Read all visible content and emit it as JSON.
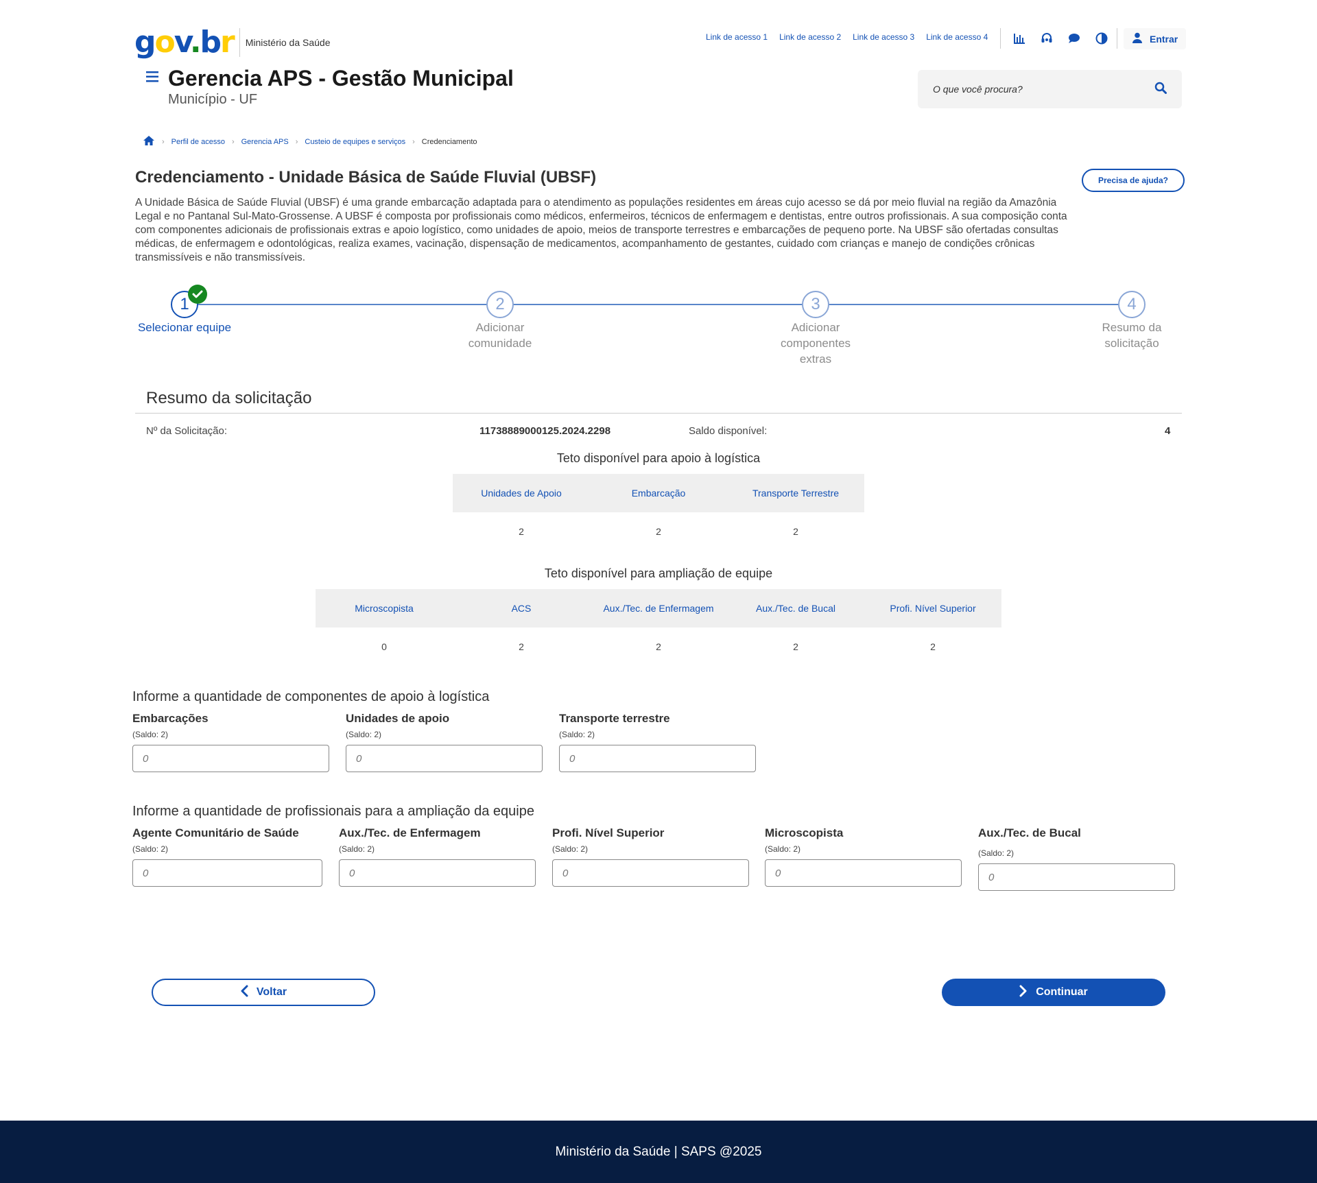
{
  "header": {
    "logo": {
      "part1": "g",
      "part2": "o",
      "part3": "v",
      "part4": ".",
      "part5": "b",
      "part6": "r"
    },
    "ministry": "Ministério da Saúde",
    "links": [
      "Link de acesso 1",
      "Link de acesso 2",
      "Link de acesso 3",
      "Link de acesso 4"
    ],
    "login_label": "Entrar",
    "icons": [
      "chart-icon",
      "headset-icon",
      "chat-icon",
      "contrast-icon",
      "user-icon"
    ]
  },
  "app": {
    "title": "Gerencia APS - Gestão Municipal",
    "subtitle": "Município - UF"
  },
  "search": {
    "placeholder": "O que você procura?"
  },
  "breadcrumb": {
    "items": [
      "Perfil de acesso",
      "Gerencia APS",
      "Custeio de equipes e serviços"
    ],
    "current": "Credenciamento"
  },
  "page": {
    "title": "Credenciamento - Unidade Básica de Saúde Fluvial (UBSF)",
    "help_label": "Precisa de ajuda?",
    "description": "A Unidade Básica de Saúde Fluvial (UBSF) é uma grande embarcação adaptada para o atendimento as populações residentes em áreas cujo acesso se dá por meio fluvial na região da Amazônia Legal e no Pantanal Sul-Mato-Grossense. A UBSF é composta por profissionais como médicos, enfermeiros, técnicos de enfermagem e dentistas, entre outros profissionais. A sua composição conta com componentes adicionais de profissionais extras e apoio logístico, como unidades de apoio, meios de transporte terrestres e embarcações de pequeno porte. Na UBSF são ofertadas consultas médicas, de enfermagem e odontológicas, realiza exames, vacinação, dispensação de medicamentos, acompanhamento de gestantes, cuidado com crianças e manejo de condições crônicas transmissíveis e não transmissíveis."
  },
  "stepper": {
    "steps": [
      {
        "number": "1",
        "label_line1": "Selecionar equipe",
        "label_line2": "",
        "label_line3": "",
        "status": "completed"
      },
      {
        "number": "2",
        "label_line1": "Adicionar",
        "label_line2": "comunidade",
        "label_line3": "",
        "status": "pending"
      },
      {
        "number": "3",
        "label_line1": "Adicionar",
        "label_line2": "componentes",
        "label_line3": "extras",
        "status": "pending"
      },
      {
        "number": "4",
        "label_line1": "Resumo da",
        "label_line2": "solicitação",
        "label_line3": "",
        "status": "pending"
      }
    ]
  },
  "summary": {
    "title": "Resumo da solicitação",
    "request_label": "Nº da Solicitação:",
    "request_value": "11738889000125.2024.2298",
    "balance_label": "Saldo disponível:",
    "balance_value": "4",
    "logistics_table": {
      "caption": "Teto disponível para apoio à logística",
      "headers": [
        "Unidades de Apoio",
        "Embarcação",
        "Transporte Terrestre"
      ],
      "values": [
        "2",
        "2",
        "2"
      ]
    },
    "team_table": {
      "caption": "Teto disponível para ampliação de equipe",
      "headers": [
        "Microscopista",
        "ACS",
        "Aux./Tec. de Enfermagem",
        "Aux./Tec. de Bucal",
        "Profi. Nível Superior"
      ],
      "values": [
        "0",
        "2",
        "2",
        "2",
        "2"
      ]
    }
  },
  "logistics_form": {
    "title": "Informe a quantidade de componentes de apoio à logística",
    "fields": [
      {
        "label": "Embarcações",
        "hint": "(Saldo: 2)",
        "placeholder": "0"
      },
      {
        "label": "Unidades de apoio",
        "hint": "(Saldo: 2)",
        "placeholder": "0"
      },
      {
        "label": "Transporte terrestre",
        "hint": "(Saldo: 2)",
        "placeholder": "0"
      }
    ]
  },
  "team_form": {
    "title": "Informe a quantidade de profissionais para a ampliação da equipe",
    "fields": [
      {
        "label": "Agente Comunitário de Saúde",
        "hint": "(Saldo: 2)",
        "placeholder": "0"
      },
      {
        "label": "Aux./Tec. de Enfermagem",
        "hint": "(Saldo: 2)",
        "placeholder": "0"
      },
      {
        "label": "Profi. Nível Superior",
        "hint": "(Saldo: 2)",
        "placeholder": "0"
      },
      {
        "label": "Microscopista",
        "hint": "(Saldo: 2)",
        "placeholder": "0"
      },
      {
        "label": "Aux./Tec. de Bucal",
        "hint": "(Saldo: 2)",
        "placeholder": "0"
      }
    ]
  },
  "actions": {
    "back_label": "Voltar",
    "next_label": "Continuar"
  },
  "footer": {
    "text": "Ministério da Saúde | SAPS @2025"
  },
  "colors": {
    "primary": "#1351b4",
    "success": "#168821",
    "footer_bg": "#071d41",
    "table_header_bg": "#efefef"
  }
}
